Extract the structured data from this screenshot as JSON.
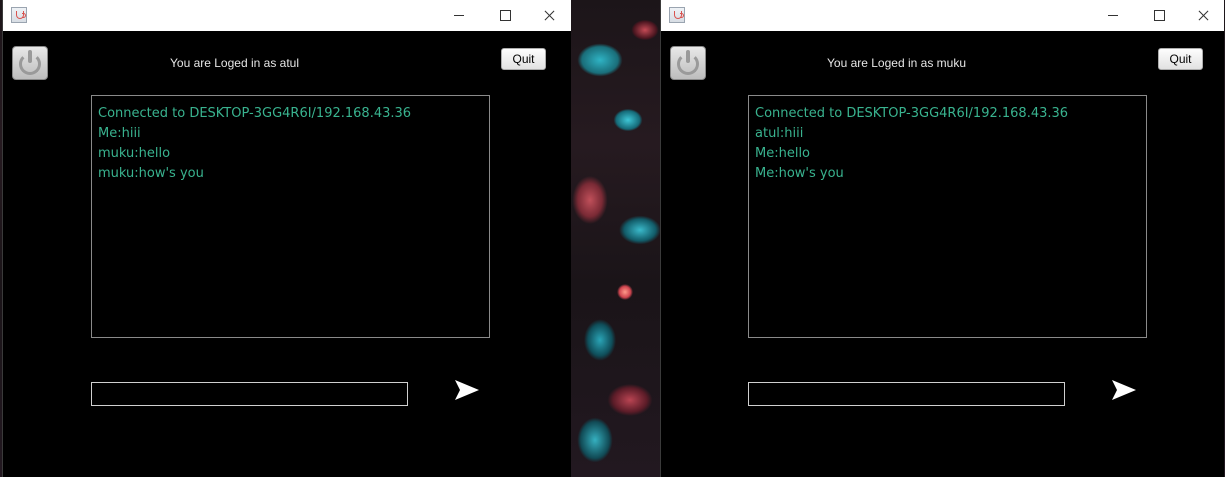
{
  "windows": [
    {
      "window_name": "chat-window-atul",
      "status_text": "You are Loged in as atul",
      "quit_label": "Quit",
      "messages": [
        "Connected to DESKTOP-3GG4R6I/192.168.43.36",
        "Me:hiii",
        "muku:hello",
        "muku:how's you"
      ],
      "input_value": "",
      "icons": {
        "app": "java-icon",
        "power": "power-icon",
        "send": "send-arrow-icon"
      }
    },
    {
      "window_name": "chat-window-muku",
      "status_text": "You are Loged in as muku",
      "quit_label": "Quit",
      "messages": [
        "Connected to DESKTOP-3GG4R6I/192.168.43.36",
        "atul:hiii",
        "Me:hello",
        "Me:how's you"
      ],
      "input_value": "",
      "icons": {
        "app": "java-icon",
        "power": "power-icon",
        "send": "send-arrow-icon"
      }
    }
  ],
  "colors": {
    "window_background": "#000000",
    "titlebar_background": "#ffffff",
    "message_text": "#39b38f",
    "status_text": "#e6e6e6"
  }
}
